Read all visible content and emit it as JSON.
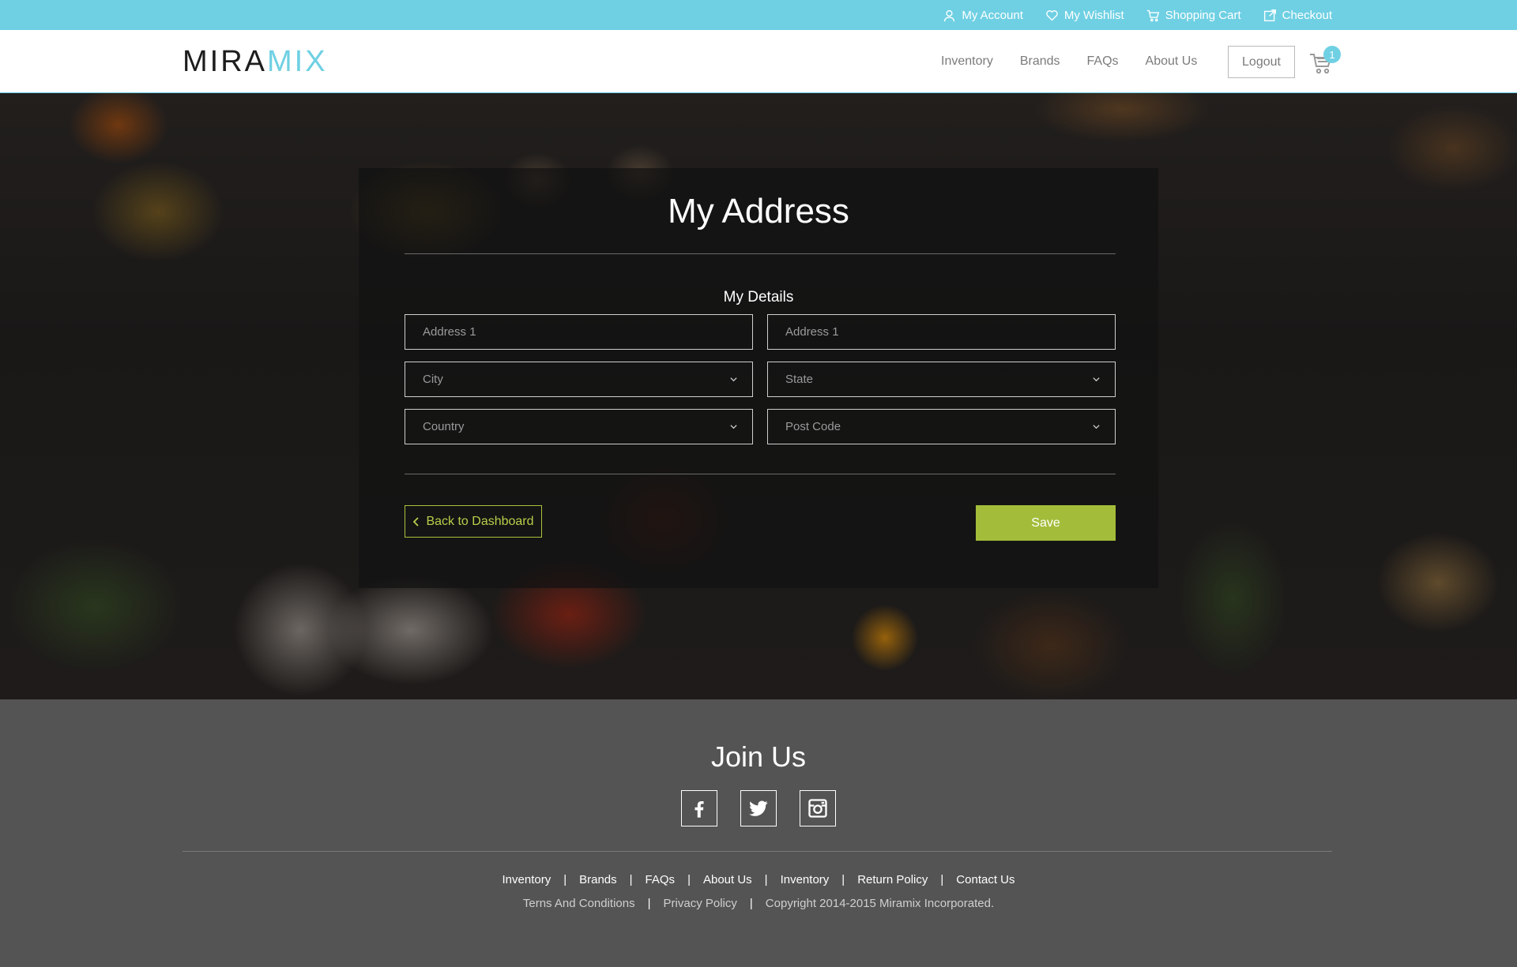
{
  "topbar": {
    "links": [
      {
        "label": "My Account",
        "icon": "user-icon"
      },
      {
        "label": "My Wishlist",
        "icon": "heart-icon"
      },
      {
        "label": "Shopping Cart",
        "icon": "cart-icon"
      },
      {
        "label": "Checkout",
        "icon": "checkout-icon"
      }
    ]
  },
  "header": {
    "logo_part1": "MIRA",
    "logo_part2": "MIX",
    "nav": [
      "Inventory",
      "Brands",
      "FAQs",
      "About Us"
    ],
    "logout_label": "Logout",
    "cart_count": "1"
  },
  "panel": {
    "title": "My Address",
    "section_title": "My Details",
    "fields": {
      "address1_left": "Address 1",
      "address1_right": "Address 1",
      "city": "City",
      "state": "State",
      "country": "Country",
      "postcode": "Post Code"
    },
    "back_label": "Back to Dashboard",
    "save_label": "Save"
  },
  "footer": {
    "join_title": "Join Us",
    "socials": [
      "facebook-icon",
      "twitter-icon",
      "instagram-icon"
    ],
    "links_row1": [
      "Inventory",
      "Brands",
      "FAQs",
      "About Us",
      "Inventory",
      "Return Policy",
      "Contact Us"
    ],
    "links_row2": [
      "Terns And Conditions",
      "Privacy Policy",
      "Copyright 2014-2015 Miramix Incorporated."
    ]
  },
  "colors": {
    "accent_cyan": "#6fd0e3",
    "accent_green": "#a3bd3a",
    "footer_bg": "#545454"
  }
}
